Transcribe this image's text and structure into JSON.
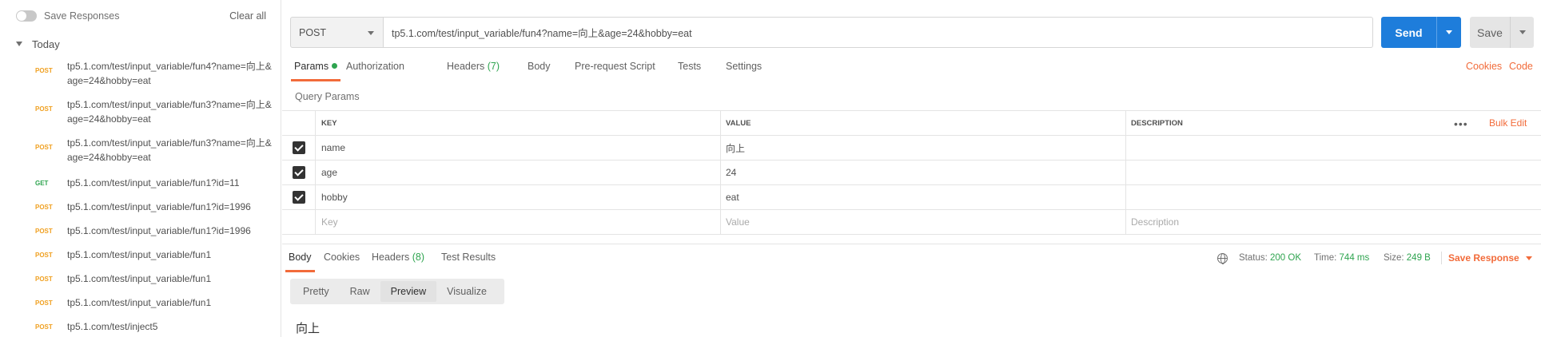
{
  "sidebar": {
    "save_responses_label": "Save Responses",
    "clear_all_label": "Clear all",
    "group_label": "Today",
    "history": [
      {
        "method": "POST",
        "url": "tp5.1.com/test/input_variable/fun4?name=向上&age=24&hobby=eat"
      },
      {
        "method": "POST",
        "url": "tp5.1.com/test/input_variable/fun3?name=向上&age=24&hobby=eat"
      },
      {
        "method": "POST",
        "url": "tp5.1.com/test/input_variable/fun3?name=向上&age=24&hobby=eat"
      },
      {
        "method": "GET",
        "url": "tp5.1.com/test/input_variable/fun1?id=11"
      },
      {
        "method": "POST",
        "url": "tp5.1.com/test/input_variable/fun1?id=1996"
      },
      {
        "method": "POST",
        "url": "tp5.1.com/test/input_variable/fun1?id=1996"
      },
      {
        "method": "POST",
        "url": "tp5.1.com/test/input_variable/fun1"
      },
      {
        "method": "POST",
        "url": "tp5.1.com/test/input_variable/fun1"
      },
      {
        "method": "POST",
        "url": "tp5.1.com/test/input_variable/fun1"
      },
      {
        "method": "POST",
        "url": "tp5.1.com/test/inject5"
      }
    ]
  },
  "request": {
    "method": "POST",
    "url": "tp5.1.com/test/input_variable/fun4?name=向上&age=24&hobby=eat",
    "send_label": "Send",
    "save_label": "Save"
  },
  "request_tabs": {
    "params": "Params",
    "authorization": "Authorization",
    "headers": "Headers",
    "headers_count": "(7)",
    "body": "Body",
    "prerequest": "Pre-request Script",
    "tests": "Tests",
    "settings": "Settings",
    "cookies": "Cookies",
    "code": "Code"
  },
  "query_params": {
    "title": "Query Params",
    "columns": {
      "key": "KEY",
      "value": "VALUE",
      "description": "DESCRIPTION"
    },
    "bulk_edit": "Bulk Edit",
    "rows": [
      {
        "key": "name",
        "value": "向上",
        "description": ""
      },
      {
        "key": "age",
        "value": "24",
        "description": ""
      },
      {
        "key": "hobby",
        "value": "eat",
        "description": ""
      }
    ],
    "placeholders": {
      "key": "Key",
      "value": "Value",
      "description": "Description"
    }
  },
  "response": {
    "tabs": {
      "body": "Body",
      "cookies": "Cookies",
      "headers": "Headers",
      "headers_count": "(8)",
      "tests": "Test Results"
    },
    "status_label": "Status:",
    "status_value": "200 OK",
    "time_label": "Time:",
    "time_value": "744 ms",
    "size_label": "Size:",
    "size_value": "249 B",
    "save_response": "Save Response",
    "views": {
      "pretty": "Pretty",
      "raw": "Raw",
      "preview": "Preview",
      "visualize": "Visualize"
    },
    "body_preview": "向上"
  },
  "colors": {
    "accent": "#f26b3a",
    "send": "#1e7ddb",
    "ok": "#2ea44f",
    "post": "#f0a020"
  }
}
